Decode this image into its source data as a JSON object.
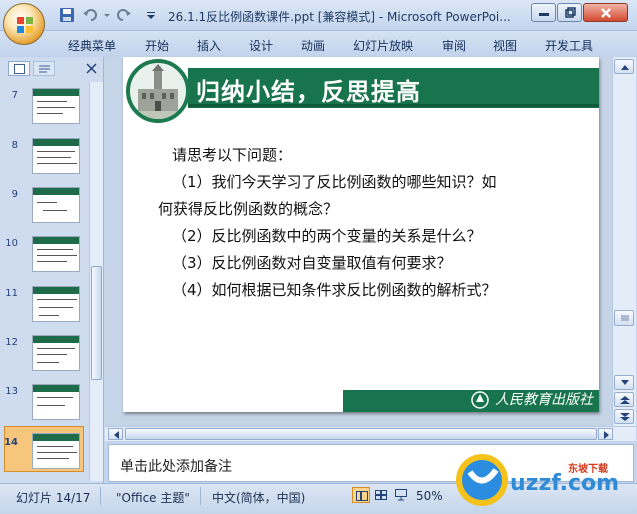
{
  "window": {
    "title": "26.1.1反比例函数课件.ppt [兼容模式] - Microsoft PowerPoi..."
  },
  "ribbon": {
    "tabs": [
      "经典菜单",
      "开始",
      "插入",
      "设计",
      "动画",
      "幻灯片放映",
      "审阅",
      "视图",
      "开发工具"
    ]
  },
  "slides_panel": {
    "thumbnails": [
      {
        "num": "7"
      },
      {
        "num": "8"
      },
      {
        "num": "9"
      },
      {
        "num": "10"
      },
      {
        "num": "11"
      },
      {
        "num": "12"
      },
      {
        "num": "13"
      },
      {
        "num": "14"
      }
    ],
    "selected": "14"
  },
  "slide": {
    "title": "归纳小结，反思提高",
    "prompt": "请思考以下问题：",
    "questions": [
      "（1）我们今天学习了反比例函数的哪些知识？如",
      "何获得反比例函数的概念？",
      "（2）反比例函数中的两个变量的关系是什么？",
      "（3）反比例函数对自变量取值有何要求？",
      "（4）如何根据已知条件求反比例函数的解析式？"
    ],
    "publisher": "人民教育出版社"
  },
  "notes": {
    "placeholder": "单击此处添加备注"
  },
  "status": {
    "slide_info": "幻灯片 14/17",
    "theme": "\"Office 主题\"",
    "language": "中文(简体，中国)",
    "zoom": "50%"
  },
  "watermark": {
    "brand": "uzzf.com",
    "sub": "东坡下载"
  },
  "colors": {
    "slide_green": "#17744c",
    "selected_thumb": "#f6c67c",
    "watermark_blue": "#2f8bd6"
  }
}
